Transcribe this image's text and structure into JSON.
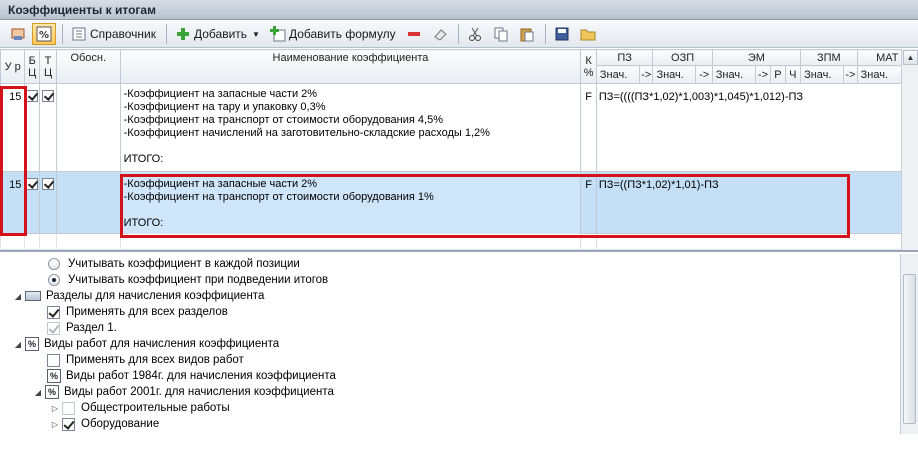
{
  "window": {
    "title": "Коэффициенты к итогам"
  },
  "toolbar": {
    "reference_label": "Справочник",
    "add_label": "Добавить",
    "add_formula_label": "Добавить формулу"
  },
  "grid": {
    "headers": {
      "level": "У р",
      "b": "Б Ц",
      "t": "Т Ц",
      "basis": "Обосн.",
      "name": "Наименование коэффициента",
      "k": "К %",
      "pz": "ПЗ",
      "ozp": "ОЗП",
      "em": "ЭМ",
      "zpm": "ЗПМ",
      "mat": "МАТ"
    },
    "sub": {
      "znach": "Знач.",
      "arrow": "->",
      "r": "Р",
      "ch": "Ч"
    },
    "rows": [
      {
        "level": "15",
        "b_checked": true,
        "t_checked": true,
        "name": "-Коэффициент на запасные части 2%\n-Коэффициент на тару и упаковку 0,3%\n-Коэффициент на транспорт от стоимости оборудования 4,5%\n-Коэффициент начислений на заготовительно-складские расходы 1,2%\n\nИТОГО:",
        "k": "F",
        "formula": "ПЗ=((((ПЗ*1,02)*1,003)*1,045)*1,012)-ПЗ"
      },
      {
        "level": "15",
        "b_checked": true,
        "t_checked": true,
        "name": "-Коэффициент на запасные части 2%\n-Коэффициент на транспорт от стоимости оборудования 1%\n\nИТОГО:",
        "k": "F",
        "formula": "ПЗ=((ПЗ*1,02)*1,01)-ПЗ"
      }
    ]
  },
  "tree": {
    "opt_each": "Учитывать коэффициент в каждой позиции",
    "opt_totals": "Учитывать коэффициент при подведении итогов",
    "sections": "Разделы для начисления коэффициента",
    "apply_all_sections": "Применять для всех разделов",
    "section1": "Раздел 1.",
    "work_types": "Виды работ для начисления коэффициента",
    "apply_all_work": "Применять для всех видов работ",
    "wt1984": "Виды работ 1984г. для начисления коэффициента",
    "wt2001": "Виды работ 2001г. для начисления коэффициента",
    "general_construction": "Общестроительные работы",
    "equipment": "Оборудование"
  },
  "colors": {
    "highlight_box": "#d4121c",
    "selected_row": "#c5dff7"
  }
}
